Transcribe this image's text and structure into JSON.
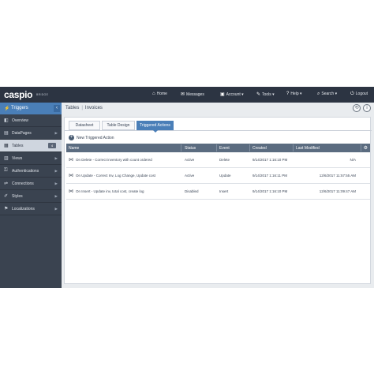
{
  "topbar": {
    "logo": "caspio",
    "logo_sub": "BRIDGE",
    "nav": [
      {
        "icon": "home-icon",
        "glyph": "⌂",
        "label": "Home"
      },
      {
        "icon": "mail-icon",
        "glyph": "✉",
        "label": "Messages"
      },
      {
        "icon": "account-icon",
        "glyph": "▣",
        "label": "Account ▾"
      },
      {
        "icon": "wrench-icon",
        "glyph": "✎",
        "label": "Tools ▾"
      },
      {
        "icon": "help-icon",
        "glyph": "?",
        "label": "Help ▾"
      },
      {
        "icon": "search-icon",
        "glyph": "⌕",
        "label": "Search ▾"
      },
      {
        "icon": "logout-icon",
        "glyph": "⏻",
        "label": "Logout"
      }
    ]
  },
  "sidebar": {
    "header": "Triggers",
    "collapse_glyph": "‹",
    "items": [
      {
        "label": "Overview",
        "glyph": "◧"
      },
      {
        "label": "DataPages",
        "glyph": "▤"
      },
      {
        "label": "Tables",
        "glyph": "▦",
        "badge": "4"
      },
      {
        "label": "Views",
        "glyph": "▥"
      },
      {
        "label": "Authentications",
        "glyph": "⚿"
      },
      {
        "label": "Connections",
        "glyph": "⇌"
      },
      {
        "label": "Styles",
        "glyph": "✐"
      },
      {
        "label": "Localizations",
        "glyph": "⚑"
      }
    ]
  },
  "breadcrumb": {
    "parent": "Tables",
    "current": "Invoices",
    "sep": "|"
  },
  "tabs": [
    {
      "label": "Datasheet"
    },
    {
      "label": "Table Design"
    },
    {
      "label": "Triggered Actions"
    }
  ],
  "new_action": "New Triggered Action",
  "table": {
    "headers": {
      "name": "Name",
      "status": "Status",
      "event": "Event",
      "created": "Created",
      "last_modified": "Last Modified"
    },
    "rows": [
      {
        "name": "On Delete - Correct inventory with count ordered",
        "status": "Active",
        "event": "Delete",
        "created": "9/14/2017 1:16:10 PM",
        "last_modified": "N/A"
      },
      {
        "name": "On Update - Correct Inv, Log Change, Update cost",
        "status": "Active",
        "event": "Update",
        "created": "9/14/2017 1:16:11 PM",
        "last_modified": "12/6/2017 11:57:55 AM"
      },
      {
        "name": "On Insert - Update inv, total cost, create log",
        "status": "Disabled",
        "event": "Insert",
        "created": "9/14/2017 1:16:10 PM",
        "last_modified": "12/6/2017 11:09:47 AM"
      }
    ]
  },
  "colors": {
    "topbar": "#2c3442",
    "accent": "#4a7fb8",
    "sidebar": "#3a4350",
    "table_header": "#5b6c80"
  }
}
